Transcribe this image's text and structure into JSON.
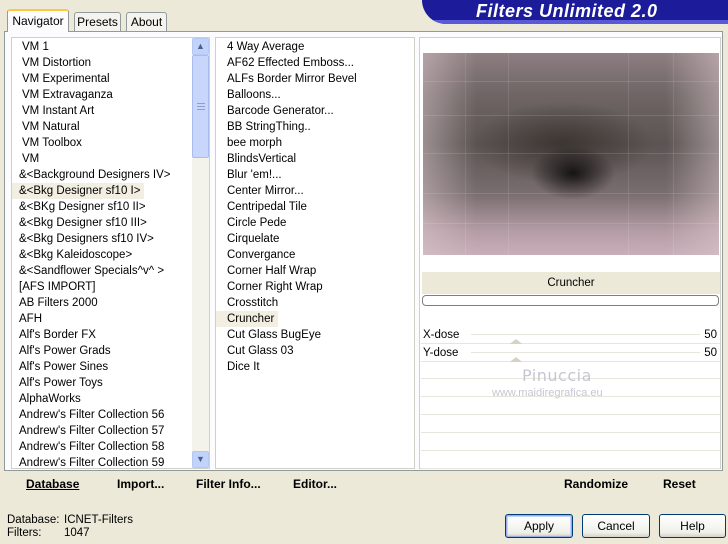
{
  "banner_title": "Filters Unlimited 2.0",
  "tabs": [
    "Navigator",
    "Presets",
    "About"
  ],
  "categories": [
    "VM 1",
    "VM Distortion",
    "VM Experimental",
    "VM Extravaganza",
    "VM Instant Art",
    "VM Natural",
    "VM Toolbox",
    "VM",
    "&<Background Designers IV>",
    "&<Bkg Designer sf10 I>",
    "&<BKg Designer sf10 II>",
    "&<Bkg Designer sf10 III>",
    "&<Bkg Designers sf10 IV>",
    "&<Bkg Kaleidoscope>",
    "&<Sandflower Specials^v^ >",
    "[AFS IMPORT]",
    "AB Filters 2000",
    "AFH",
    "Alf's Border FX",
    "Alf's Power Grads",
    "Alf's Power Sines",
    "Alf's Power Toys",
    "AlphaWorks",
    "Andrew's Filter Collection 56",
    "Andrew's Filter Collection 57",
    "Andrew's Filter Collection 58",
    "Andrew's Filter Collection 59"
  ],
  "selected_category": "&<Bkg Designer sf10 I>",
  "filters": [
    "4 Way Average",
    "AF62 Effected Emboss...",
    "ALFs Border Mirror Bevel",
    "Balloons...",
    "Barcode Generator...",
    "BB StringThing..",
    "bee morph",
    "BlindsVertical",
    "Blur 'em!...",
    "Center Mirror...",
    "Centripedal Tile",
    "Circle Pede",
    "Cirquelate",
    "Convergance",
    "Corner Half Wrap",
    "Corner Right Wrap",
    "Crosstitch",
    "Cruncher",
    "Cut Glass  BugEye",
    "Cut Glass 03",
    "Dice It"
  ],
  "selected_filter": "Cruncher",
  "filter_name": "Cruncher",
  "progress": 0,
  "params": [
    {
      "label": "X-dose",
      "value": "50",
      "fraction": 0.196
    },
    {
      "label": "Y-dose",
      "value": "50",
      "fraction": 0.196
    }
  ],
  "watermark": {
    "line1": "Pinuccia",
    "line2": "www.maidiregrafica.eu"
  },
  "toolbar": {
    "database": "Database",
    "import": "Import...",
    "filter_info": "Filter Info...",
    "editor": "Editor...",
    "randomize": "Randomize",
    "reset": "Reset"
  },
  "status": {
    "database_label": "Database:",
    "database_value": "ICNET-Filters",
    "filters_label": "Filters:",
    "filters_value": "1047"
  },
  "buttons": {
    "apply": "Apply",
    "cancel": "Cancel",
    "help": "Help"
  },
  "icons": {
    "scroll_up": "chevron-up-icon",
    "scroll_down": "chevron-down-icon"
  }
}
